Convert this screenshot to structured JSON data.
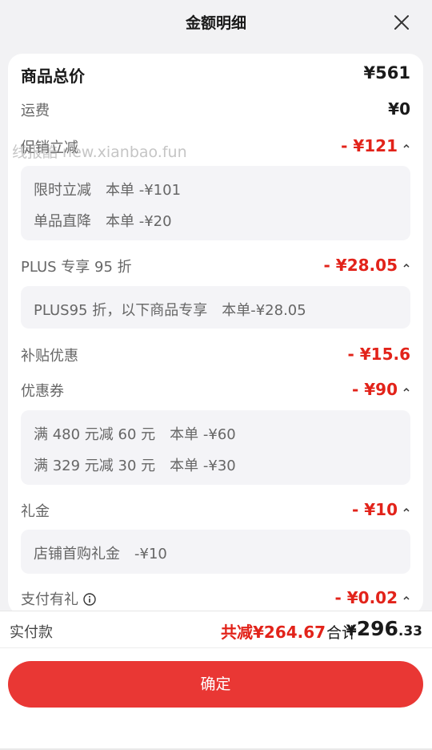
{
  "header": {
    "title": "金额明细"
  },
  "summary": {
    "goods_total_label": "商品总价",
    "goods_total_value": "¥561",
    "shipping_label": "运费",
    "shipping_value": "¥0"
  },
  "promo": {
    "label": "促销立减",
    "value": "- ¥121",
    "details": [
      "限时立减　本单 -¥101",
      "单品直降　本单 -¥20"
    ]
  },
  "plus": {
    "label": "PLUS 专享 95 折",
    "value": "- ¥28.05",
    "details": [
      "PLUS95 折，以下商品专享　本单-¥28.05"
    ]
  },
  "subsidy": {
    "label": "补贴优惠",
    "value": "- ¥15.6"
  },
  "coupon": {
    "label": "优惠券",
    "value": "- ¥90",
    "details": [
      "满 480 元减 60 元　本单 -¥60",
      "满 329 元减 30 元　本单 -¥30"
    ]
  },
  "gift": {
    "label": "礼金",
    "value": "- ¥10",
    "details": [
      "店铺首购礼金　-¥10"
    ]
  },
  "pay_gift": {
    "label": "支付有礼",
    "value": "- ¥0.02"
  },
  "watermark": "线报酷 new.xianbao.fun",
  "footer": {
    "pay_label": "实付款",
    "saving": "共减¥264.67",
    "total_label": "合计",
    "total_currency": "¥",
    "total_integer": "296",
    "total_decimal": ".33",
    "confirm_label": "确定"
  },
  "colors": {
    "accent": "#e2231a",
    "button": "#e93734"
  },
  "icons": [
    "close-icon",
    "chevron-up-icon",
    "info-icon"
  ]
}
